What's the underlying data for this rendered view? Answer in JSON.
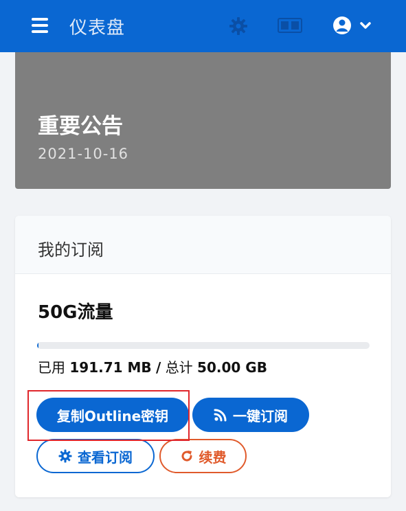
{
  "header": {
    "title": "仪表盘",
    "icons": [
      "menu-icon",
      "gear-icon",
      "language-icon",
      "user-avatar-icon",
      "chevron-down-icon"
    ],
    "bg_color": "#0a67d2"
  },
  "announcement": {
    "title": "重要公告",
    "date": "2021-10-16"
  },
  "subscription": {
    "card_title": "我的订阅",
    "plan_name": "50G流量",
    "usage_label_used": "已用",
    "usage_used": "191.71 MB",
    "usage_sep": "/",
    "usage_label_total": "总计",
    "usage_total": "50.00 GB",
    "progress_fraction": 0.0037,
    "buttons": {
      "copy": "复制Outline密钥",
      "subscribe": "一键订阅",
      "view": "查看订阅",
      "renew": "续费"
    }
  },
  "colors": {
    "primary": "#0a67d2",
    "renew": "#e05a2b",
    "highlight": "#e0262b"
  }
}
